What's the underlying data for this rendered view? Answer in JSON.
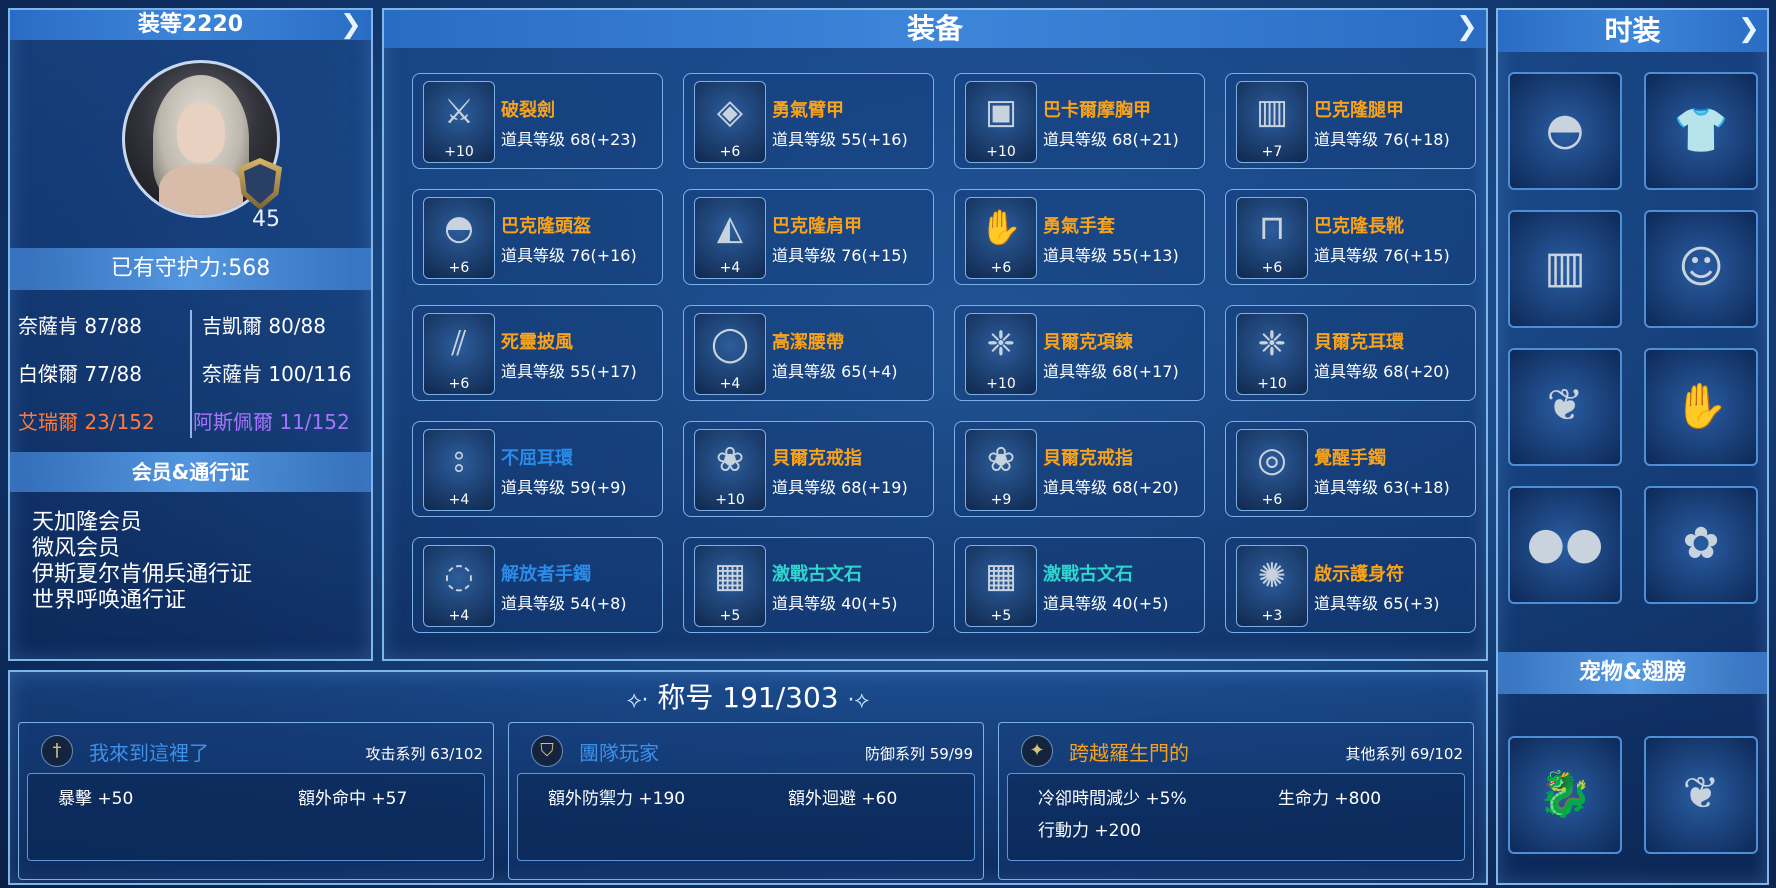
{
  "left": {
    "gear_score": "装等2220",
    "level": "45",
    "guard_power": "已有守护力:568",
    "stats": [
      {
        "text": "奈薩肯 87/88",
        "color": "#ffffff"
      },
      {
        "text": "吉凱爾 80/88",
        "color": "#ffffff"
      },
      {
        "text": "白傑爾 77/88",
        "color": "#ffffff"
      },
      {
        "text": "奈薩肯 100/116",
        "color": "#ffffff"
      },
      {
        "text": "艾瑞爾 23/152",
        "color": "#ff7a3c"
      },
      {
        "text": "阿斯佩爾 11/152",
        "color": "#a774ff"
      }
    ],
    "membership_title": "会员&通行证",
    "memberships": [
      "天加隆会员",
      "微风会员",
      "伊斯夏尔肯佣兵通行证",
      "世界呼唤通行证"
    ]
  },
  "equipment": {
    "title": "装备",
    "items": [
      {
        "name": "破裂劍",
        "level": "道具等级 68(+23)",
        "plus": "+10",
        "color": "orange",
        "icon": "sword-icon",
        "glyph": "⚔"
      },
      {
        "name": "勇氣臂甲",
        "level": "道具等级 55(+16)",
        "plus": "+6",
        "color": "orange",
        "icon": "arm-guard-icon",
        "glyph": "◈"
      },
      {
        "name": "巴卡爾摩胸甲",
        "level": "道具等级 68(+21)",
        "plus": "+10",
        "color": "orange",
        "icon": "chest-armor-icon",
        "glyph": "▣"
      },
      {
        "name": "巴克隆腿甲",
        "level": "道具等级 76(+18)",
        "plus": "+7",
        "color": "orange",
        "icon": "leg-armor-icon",
        "glyph": "▥"
      },
      {
        "name": "巴克隆頭盔",
        "level": "道具等级 76(+16)",
        "plus": "+6",
        "color": "orange",
        "icon": "helmet-icon",
        "glyph": "◓"
      },
      {
        "name": "巴克隆肩甲",
        "level": "道具等级 76(+15)",
        "plus": "+4",
        "color": "orange",
        "icon": "shoulder-armor-icon",
        "glyph": "◭"
      },
      {
        "name": "勇氣手套",
        "level": "道具等级 55(+13)",
        "plus": "+6",
        "color": "orange",
        "icon": "gloves-icon",
        "glyph": "✋"
      },
      {
        "name": "巴克隆長靴",
        "level": "道具等级 76(+15)",
        "plus": "+6",
        "color": "orange",
        "icon": "boots-icon",
        "glyph": "⊓"
      },
      {
        "name": "死靈披風",
        "level": "道具等级 55(+17)",
        "plus": "+6",
        "color": "orange",
        "icon": "cloak-icon",
        "glyph": "⫽"
      },
      {
        "name": "高潔腰帶",
        "level": "道具等级 65(+4)",
        "plus": "+4",
        "color": "orange",
        "icon": "belt-icon",
        "glyph": "◯"
      },
      {
        "name": "貝爾克項鍊",
        "level": "道具等级 68(+17)",
        "plus": "+10",
        "color": "orange",
        "icon": "necklace-icon",
        "glyph": "❈"
      },
      {
        "name": "貝爾克耳環",
        "level": "道具等级 68(+20)",
        "plus": "+10",
        "color": "orange",
        "icon": "earring-icon",
        "glyph": "❈"
      },
      {
        "name": "不屈耳環",
        "level": "道具等级 59(+9)",
        "plus": "+4",
        "color": "blue",
        "icon": "earring-icon",
        "glyph": "⦂"
      },
      {
        "name": "貝爾克戒指",
        "level": "道具等级 68(+19)",
        "plus": "+10",
        "color": "orange",
        "icon": "ring-icon",
        "glyph": "❀"
      },
      {
        "name": "貝爾克戒指",
        "level": "道具等级 68(+20)",
        "plus": "+9",
        "color": "orange",
        "icon": "ring-icon",
        "glyph": "❀"
      },
      {
        "name": "覺醒手鐲",
        "level": "道具等级 63(+18)",
        "plus": "+6",
        "color": "orange",
        "icon": "bracelet-icon",
        "glyph": "◎"
      },
      {
        "name": "解放者手鐲",
        "level": "道具等级 54(+8)",
        "plus": "+4",
        "color": "blue",
        "icon": "bracelet-icon",
        "glyph": "◌"
      },
      {
        "name": "激戰古文石",
        "level": "道具等级 40(+5)",
        "plus": "+5",
        "color": "cyan",
        "icon": "rune-stone-icon",
        "glyph": "▦"
      },
      {
        "name": "激戰古文石",
        "level": "道具等级 40(+5)",
        "plus": "+5",
        "color": "cyan",
        "icon": "rune-stone-icon",
        "glyph": "▦"
      },
      {
        "name": "啟示護身符",
        "level": "道具等级 65(+3)",
        "plus": "+3",
        "color": "orange",
        "icon": "amulet-icon",
        "glyph": "✺"
      }
    ]
  },
  "fashion": {
    "title": "时装",
    "items": [
      {
        "icon": "fashion-helmet-icon",
        "glyph": "◓"
      },
      {
        "icon": "fashion-top-icon",
        "glyph": "👕"
      },
      {
        "icon": "fashion-shorts-icon",
        "glyph": "▥"
      },
      {
        "icon": "fashion-mask-icon",
        "glyph": "☺"
      },
      {
        "icon": "fashion-wing-arm-icon",
        "glyph": "❦"
      },
      {
        "icon": "fashion-glove-icon",
        "glyph": "✋"
      },
      {
        "icon": "fashion-paws-icon",
        "glyph": "●●"
      },
      {
        "icon": "fashion-weapon-icon",
        "glyph": "✿"
      }
    ],
    "pet_title": "宠物&翅膀",
    "pets": [
      {
        "icon": "pet-dragon-icon",
        "glyph": "🐉"
      },
      {
        "icon": "wings-icon",
        "glyph": "❦"
      }
    ]
  },
  "titles": {
    "heading": "称号 191/303",
    "cards": [
      {
        "icon": "sword-emblem-icon",
        "glyph": "†",
        "name": "我來到這裡了",
        "name_color": "#3d8fe8",
        "series": "攻击系列 63/102",
        "stats": [
          "暴擊 +50",
          "額外命中 +57"
        ]
      },
      {
        "icon": "shield-emblem-icon",
        "glyph": "⛉",
        "name": "團隊玩家",
        "name_color": "#3d8fe8",
        "series": "防御系列 59/99",
        "stats": [
          "額外防禦力 +190",
          "額外迴避 +60"
        ]
      },
      {
        "icon": "star-emblem-icon",
        "glyph": "✦",
        "name": "跨越羅生門的",
        "name_color": "#f7a21b",
        "series": "其他系列 69/102",
        "stats": [
          "冷卻時間減少 +5%",
          "生命力 +800",
          "行動力 +200"
        ]
      }
    ]
  }
}
